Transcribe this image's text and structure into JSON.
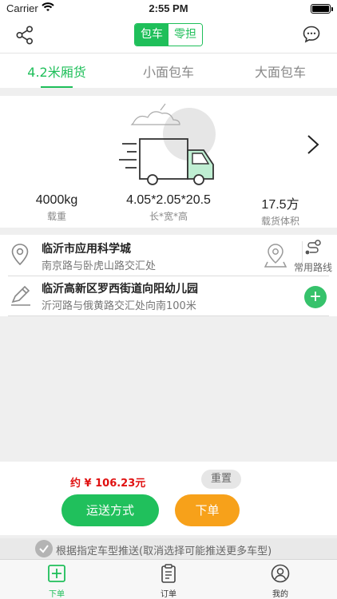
{
  "status_bar": {
    "carrier": "Carrier",
    "time": "2:55 PM",
    "battery_level": 1.0
  },
  "nav": {
    "segment": [
      {
        "label": "包车",
        "selected": true
      },
      {
        "label": "零担",
        "selected": false
      }
    ],
    "share_icon": "share-icon",
    "message_icon": "chat-bubble-icon"
  },
  "vehicle_tabs": [
    {
      "label": "4.2米厢货",
      "active": true
    },
    {
      "label": "小面包车",
      "active": false
    },
    {
      "label": "大面包车",
      "active": false
    }
  ],
  "vehicle": {
    "specs": [
      {
        "value": "4000kg",
        "label": "载重"
      },
      {
        "value": "4.05*2.05*20.5",
        "label": "长*宽*高"
      },
      {
        "value": "17.5方",
        "label": "载货体积"
      }
    ],
    "next_icon": "chevron-right-icon"
  },
  "addresses": [
    {
      "name": "临沂市应用科学城",
      "detail": "南京路与卧虎山路交汇处",
      "icon": "location-pin-icon"
    },
    {
      "name": "临沂高新区罗西街道向阳幼儿园",
      "detail": "沂河路与俄黄路交汇处向南100米",
      "icon": "edit-pencil-icon"
    }
  ],
  "route": {
    "label": "常用路线"
  },
  "bottom": {
    "price": "约 ¥ 106.23元",
    "reset_label": "重置",
    "ship_label": "运送方式",
    "order_label": "下单"
  },
  "notice": {
    "text": "根据指定车型推送(取消选择可能推送更多车型)"
  },
  "tabbar": [
    {
      "label": "下单",
      "active": true
    },
    {
      "label": "订单",
      "active": false
    },
    {
      "label": "我的",
      "active": false
    }
  ],
  "colors": {
    "accent": "#1fbf5a",
    "orange": "#f7a11a",
    "price": "#e01010"
  }
}
